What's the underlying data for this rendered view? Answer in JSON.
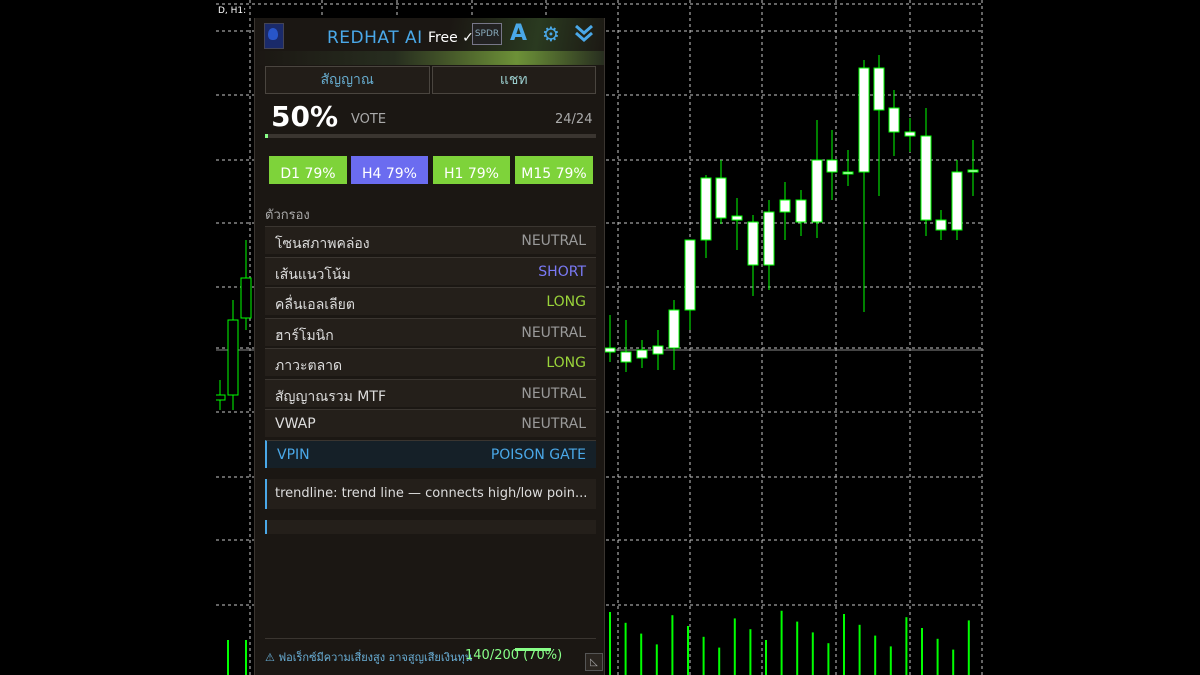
{
  "chart": {
    "symbol_label": "D, H1: ",
    "grid_color": "#c8c8c8",
    "bull_color": "#00ff00",
    "candle_body_color": "#ffffff"
  },
  "panel": {
    "app_title": "REDHAT AI",
    "plan": "Free ✓",
    "spdr_label": "SPDR",
    "icons": [
      "font-icon",
      "gear-icon",
      "double-chevron-down-icon"
    ],
    "tabs": [
      {
        "label": "สัญญาณ"
      },
      {
        "label": "แชท"
      }
    ],
    "vote": {
      "percent": "50%",
      "label": "VOTE",
      "count": "24/24",
      "fill_fraction": 0.01
    },
    "timeframes": [
      {
        "label": "D1 79%",
        "color": "#7ed33a"
      },
      {
        "label": "H4 79%",
        "color": "#6b6cf0"
      },
      {
        "label": "H1 79%",
        "color": "#7ed33a"
      },
      {
        "label": "M15 79%",
        "color": "#7ed33a"
      }
    ],
    "filters_title": "ตัวกรอง",
    "filters": [
      {
        "name": "โซนสภาพคล่อง",
        "value": "NEUTRAL",
        "color": "#9a9a9a"
      },
      {
        "name": "เส้นแนวโน้ม",
        "value": "SHORT",
        "color": "#7a7af5"
      },
      {
        "name": "คลื่นเอลเลียต",
        "value": "LONG",
        "color": "#9ad43a"
      },
      {
        "name": "ฮาร์โมนิก",
        "value": "NEUTRAL",
        "color": "#9a9a9a"
      },
      {
        "name": "ภาวะตลาด",
        "value": "LONG",
        "color": "#9ad43a"
      },
      {
        "name": "สัญญาณรวม MTF",
        "value": "NEUTRAL",
        "color": "#9a9a9a"
      },
      {
        "name": "VWAP",
        "value": "NEUTRAL",
        "color": "#9a9a9a"
      },
      {
        "name": "VPIN",
        "value": "POISON GATE",
        "color": "#4aa8e8"
      }
    ],
    "info_text": "trendline: trend line — connects high/low poin...",
    "warning": "⚠ ฟอเร็กซ์มีความเสี่ยงสูง อาจสูญเสียเงินทุน",
    "usage": "140/200 (70%)"
  }
}
